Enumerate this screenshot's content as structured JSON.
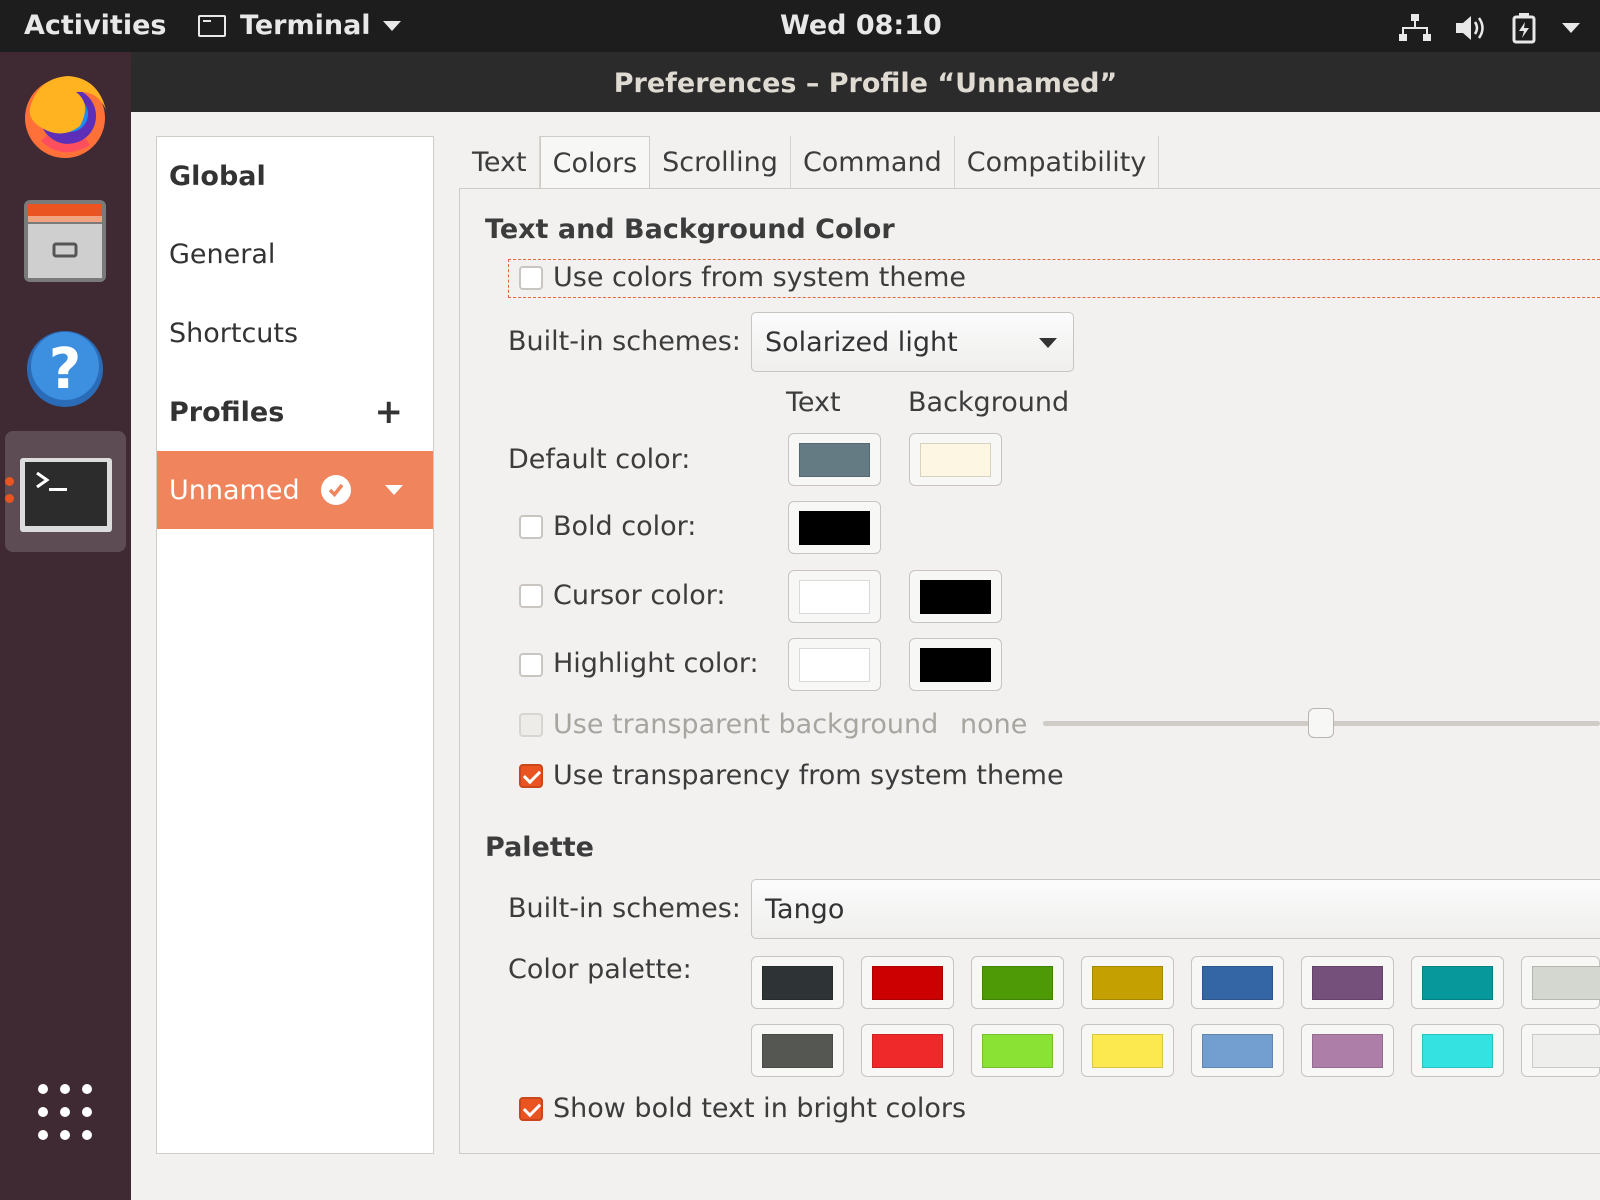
{
  "topbar": {
    "activities": "Activities",
    "app_menu": "Terminal",
    "clock": "Wed 08:10",
    "tray_icons": [
      "network-icon",
      "volume-icon",
      "battery-icon",
      "system-menu-icon"
    ]
  },
  "dock": {
    "apps": [
      "firefox-icon",
      "files-icon",
      "help-icon",
      "terminal-icon",
      "app-grid-icon"
    ]
  },
  "window": {
    "title": "Preferences – Profile “Unnamed”"
  },
  "sidebar": {
    "global": "Global",
    "general": "General",
    "shortcuts": "Shortcuts",
    "profiles": "Profiles",
    "add_profile": "+",
    "profile_name": "Unnamed"
  },
  "tabs": [
    "Text",
    "Colors",
    "Scrolling",
    "Command",
    "Compatibility"
  ],
  "active_tab": "Colors",
  "colors": {
    "section_title": "Text and Background Color",
    "use_system_theme": "Use colors from system theme",
    "builtin_label": "Built-in schemes:",
    "builtin_value": "Solarized light",
    "col_text": "Text",
    "col_background": "Background",
    "default_color": "Default color:",
    "bold_color": "Bold color:",
    "cursor_color": "Cursor color:",
    "highlight_color": "Highlight color:",
    "transparent_bg": "Use transparent background",
    "transparency_value": "none",
    "transparency_level": 0.5,
    "system_transparency": "Use transparency from system theme",
    "swatches": {
      "default_text": "#657b83",
      "default_bg": "#fdf6e3",
      "bold_text": "#000000",
      "cursor_text": "#ffffff",
      "cursor_bg": "#000000",
      "highlight_text": "#ffffff",
      "highlight_bg": "#000000"
    }
  },
  "palette": {
    "section_title": "Palette",
    "builtin_label": "Built-in schemes:",
    "builtin_value": "Tango",
    "palette_label": "Color palette:",
    "row1": [
      "#2e3436",
      "#cc0000",
      "#4e9a06",
      "#c4a000",
      "#3465a4",
      "#75507b",
      "#06989a",
      "#d3d7cf"
    ],
    "row2": [
      "#555753",
      "#ef2929",
      "#8ae234",
      "#fce94f",
      "#729fcf",
      "#ad7fa8",
      "#34e2e2",
      "#eeeeec"
    ],
    "bold_bright": "Show bold text in bright colors"
  }
}
